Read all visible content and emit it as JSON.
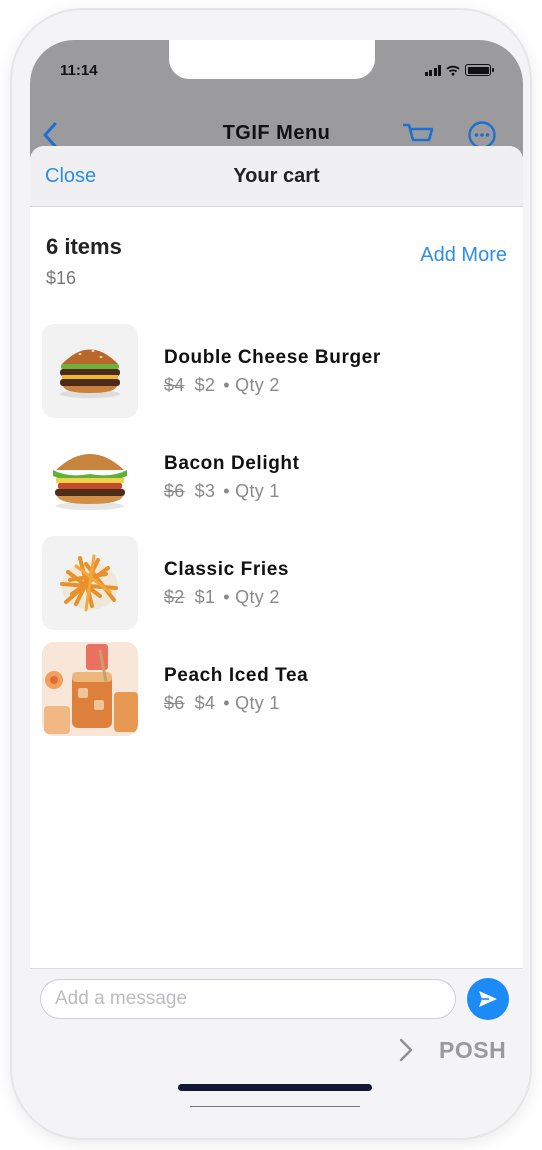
{
  "status_bar": {
    "time": "11:14"
  },
  "topbar": {
    "title": "TGIF Menu"
  },
  "sheet": {
    "close_label": "Close",
    "title": "Your cart"
  },
  "summary": {
    "count": "6 items",
    "total": "$16",
    "add_more_label": "Add More"
  },
  "items": [
    {
      "name": "Double Cheese Burger",
      "old_price": "$4",
      "price": "$2",
      "qty": "• Qty 2",
      "icon": "burger-image"
    },
    {
      "name": "Bacon Delight",
      "old_price": "$6",
      "price": "$3",
      "qty": "• Qty 1",
      "icon": "bacon-burger-image"
    },
    {
      "name": "Classic Fries",
      "old_price": "$2",
      "price": "$1",
      "qty": "• Qty 2",
      "icon": "fries-image"
    },
    {
      "name": "Peach Iced Tea",
      "old_price": "$6",
      "price": "$4",
      "qty": "• Qty 1",
      "icon": "iced-tea-image"
    }
  ],
  "composer": {
    "placeholder": "Add a message",
    "brand": "POSH"
  },
  "colors": {
    "accent": "#2d8ee8",
    "send": "#1c8bf5",
    "backdrop": "#9b9b9d"
  }
}
